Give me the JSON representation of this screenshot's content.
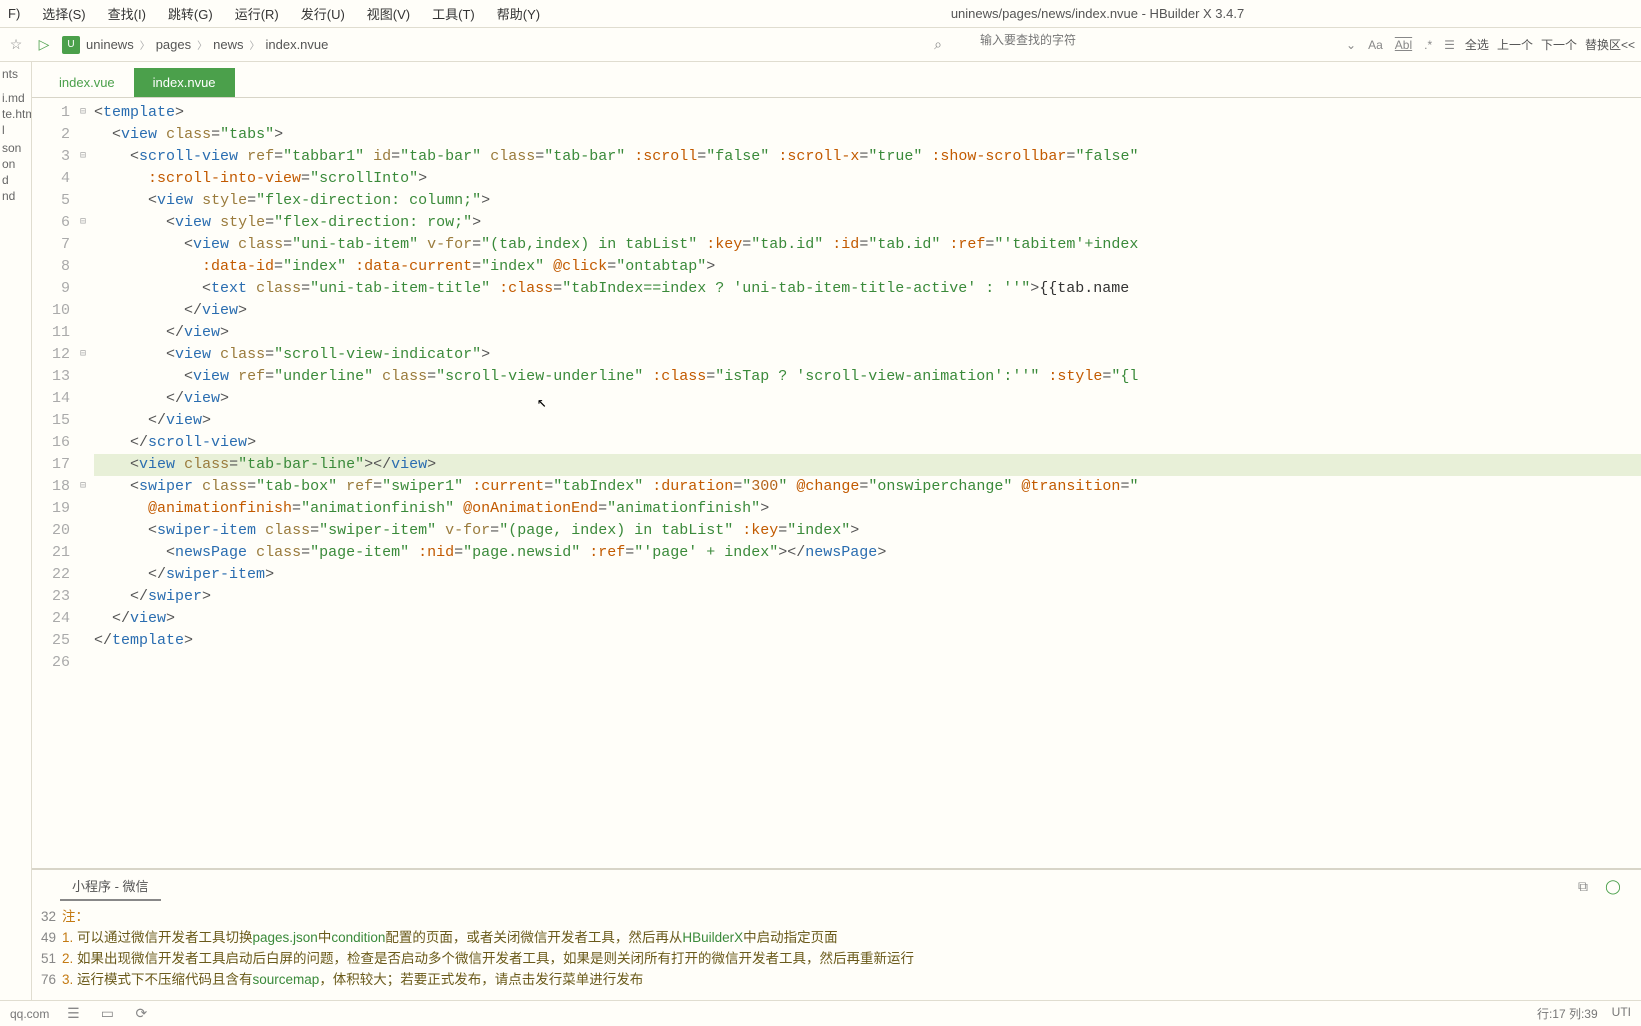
{
  "window_title": "uninews/pages/news/index.nvue - HBuilder X 3.4.7",
  "menu": {
    "file": "F)",
    "select": "选择(S)",
    "find": "查找(I)",
    "goto": "跳转(G)",
    "run": "运行(R)",
    "publish": "发行(U)",
    "view": "视图(V)",
    "tool": "工具(T)",
    "help": "帮助(Y)"
  },
  "breadcrumb": {
    "proj_icon": "U",
    "items": [
      "uninews",
      "pages",
      "news",
      "index.nvue"
    ]
  },
  "search": {
    "placeholder": "输入要查找的字符",
    "aa": "Aa",
    "abl": "Abl",
    "select_all": "全选",
    "prev": "上一个",
    "next": "下一个",
    "replace": "替换区<<"
  },
  "sidebar_files": [
    "nts",
    "",
    "",
    "",
    "",
    "i.md",
    "te.html",
    "l",
    "",
    "son",
    "on",
    "d",
    "nd"
  ],
  "tabs": [
    {
      "label": "index.vue",
      "active": false
    },
    {
      "label": "index.nvue",
      "active": true
    }
  ],
  "code": {
    "lines": [
      {
        "n": 1,
        "fold": "⊟",
        "html": "<span class='t-sym'>&lt;</span><span class='t-tag'>template</span><span class='t-sym'>&gt;</span>"
      },
      {
        "n": 2,
        "html": "  <span class='t-sym'>&lt;</span><span class='t-tag'>view</span> <span class='t-attr'>class</span><span class='t-sym'>=</span><span class='t-str'>\"tabs\"</span><span class='t-sym'>&gt;</span>"
      },
      {
        "n": 3,
        "fold": "⊟",
        "html": "    <span class='t-sym'>&lt;</span><span class='t-tag'>scroll-view</span> <span class='t-attr'>ref</span><span class='t-sym'>=</span><span class='t-str'>\"tabbar1\"</span> <span class='t-attr'>id</span><span class='t-sym'>=</span><span class='t-str'>\"tab-bar\"</span> <span class='t-attr'>class</span><span class='t-sym'>=</span><span class='t-str'>\"tab-bar\"</span> <span class='t-bind'>:scroll</span><span class='t-sym'>=</span><span class='t-str'>\"false\"</span> <span class='t-bind'>:scroll-x</span><span class='t-sym'>=</span><span class='t-str'>\"true\"</span> <span class='t-bind'>:show-scrollbar</span><span class='t-sym'>=</span><span class='t-str'>\"false\"</span>"
      },
      {
        "n": 4,
        "html": "      <span class='t-bind'>:scroll-into-view</span><span class='t-sym'>=</span><span class='t-str'>\"scrollInto\"</span><span class='t-sym'>&gt;</span>"
      },
      {
        "n": 5,
        "html": "      <span class='t-sym'>&lt;</span><span class='t-tag'>view</span> <span class='t-attr'>style</span><span class='t-sym'>=</span><span class='t-str'>\"flex-direction: column;\"</span><span class='t-sym'>&gt;</span>"
      },
      {
        "n": 6,
        "fold": "⊟",
        "html": "        <span class='t-sym'>&lt;</span><span class='t-tag'>view</span> <span class='t-attr'>style</span><span class='t-sym'>=</span><span class='t-str'>\"flex-direction: row;\"</span><span class='t-sym'>&gt;</span>"
      },
      {
        "n": 7,
        "html": "          <span class='t-sym'>&lt;</span><span class='t-tag'>view</span> <span class='t-attr'>class</span><span class='t-sym'>=</span><span class='t-str'>\"uni-tab-item\"</span> <span class='t-attr'>v-for</span><span class='t-sym'>=</span><span class='t-str'>\"(tab,index) in tabList\"</span> <span class='t-bind'>:key</span><span class='t-sym'>=</span><span class='t-str'>\"tab.id\"</span> <span class='t-bind'>:id</span><span class='t-sym'>=</span><span class='t-str'>\"tab.id\"</span> <span class='t-bind'>:ref</span><span class='t-sym'>=</span><span class='t-str'>\"'tabitem'+index</span>"
      },
      {
        "n": 8,
        "html": "            <span class='t-bind'>:data-id</span><span class='t-sym'>=</span><span class='t-str'>\"index\"</span> <span class='t-bind'>:data-current</span><span class='t-sym'>=</span><span class='t-str'>\"index\"</span> <span class='t-bind'>@click</span><span class='t-sym'>=</span><span class='t-str'>\"ontabtap\"</span><span class='t-sym'>&gt;</span>"
      },
      {
        "n": 9,
        "html": "            <span class='t-sym'>&lt;</span><span class='t-tag'>text</span> <span class='t-attr'>class</span><span class='t-sym'>=</span><span class='t-str'>\"uni-tab-item-title\"</span> <span class='t-bind'>:class</span><span class='t-sym'>=</span><span class='t-str'>\"tabIndex==index ? 'uni-tab-item-title-active' : ''\"</span><span class='t-sym'>&gt;</span><span class='t-expr'>{{tab.name</span>"
      },
      {
        "n": 10,
        "html": "          <span class='t-sym'>&lt;/</span><span class='t-tag'>view</span><span class='t-sym'>&gt;</span>"
      },
      {
        "n": 11,
        "html": "        <span class='t-sym'>&lt;/</span><span class='t-tag'>view</span><span class='t-sym'>&gt;</span>"
      },
      {
        "n": 12,
        "fold": "⊟",
        "html": "        <span class='t-sym'>&lt;</span><span class='t-tag'>view</span> <span class='t-attr'>class</span><span class='t-sym'>=</span><span class='t-str'>\"scroll-view-indicator\"</span><span class='t-sym'>&gt;</span>"
      },
      {
        "n": 13,
        "html": "          <span class='t-sym'>&lt;</span><span class='t-tag'>view</span> <span class='t-attr'>ref</span><span class='t-sym'>=</span><span class='t-str'>\"underline\"</span> <span class='t-attr'>class</span><span class='t-sym'>=</span><span class='t-str'>\"scroll-view-underline\"</span> <span class='t-bind'>:class</span><span class='t-sym'>=</span><span class='t-str'>\"isTap ? 'scroll-view-animation':''\"</span> <span class='t-bind'>:style</span><span class='t-sym'>=</span><span class='t-str'>\"{l</span>"
      },
      {
        "n": 14,
        "html": "        <span class='t-sym'>&lt;/</span><span class='t-tag'>view</span><span class='t-sym'>&gt;</span>"
      },
      {
        "n": 15,
        "html": "      <span class='t-sym'>&lt;/</span><span class='t-tag'>view</span><span class='t-sym'>&gt;</span>"
      },
      {
        "n": 16,
        "html": "    <span class='t-sym'>&lt;/</span><span class='t-tag'>scroll-view</span><span class='t-sym'>&gt;</span>"
      },
      {
        "n": 17,
        "hl": true,
        "html": "    <span class='t-sym'>&lt;</span><span class='t-tag'>view</span> <span class='t-attr'>class</span><span class='t-sym'>=</span><span class='t-str'>\"tab-bar-line\"</span><span class='t-sym'>&gt;&lt;/</span><span class='t-tag'>view</span><span class='t-sym'>&gt;</span>"
      },
      {
        "n": 18,
        "fold": "⊟",
        "html": "    <span class='t-sym'>&lt;</span><span class='t-tag'>swiper</span> <span class='t-attr'>class</span><span class='t-sym'>=</span><span class='t-str'>\"tab-box\"</span> <span class='t-attr'>ref</span><span class='t-sym'>=</span><span class='t-str'>\"swiper1\"</span> <span class='t-bind'>:current</span><span class='t-sym'>=</span><span class='t-str'>\"tabIndex\"</span> <span class='t-bind'>:duration</span><span class='t-sym'>=</span><span class='t-str'>\"</span><span class='t-num'>300</span><span class='t-str'>\"</span> <span class='t-bind'>@change</span><span class='t-sym'>=</span><span class='t-str'>\"onswiperchange\"</span> <span class='t-bind'>@transition</span><span class='t-sym'>=</span><span class='t-str'>\"</span>"
      },
      {
        "n": 19,
        "html": "      <span class='t-bind'>@animationfinish</span><span class='t-sym'>=</span><span class='t-str'>\"animationfinish\"</span> <span class='t-bind'>@onAnimationEnd</span><span class='t-sym'>=</span><span class='t-str'>\"animationfinish\"</span><span class='t-sym'>&gt;</span>"
      },
      {
        "n": 20,
        "html": "      <span class='t-sym'>&lt;</span><span class='t-tag'>swiper-item</span> <span class='t-attr'>class</span><span class='t-sym'>=</span><span class='t-str'>\"swiper-item\"</span> <span class='t-attr'>v-for</span><span class='t-sym'>=</span><span class='t-str'>\"(page, index) in tabList\"</span> <span class='t-bind'>:key</span><span class='t-sym'>=</span><span class='t-str'>\"index\"</span><span class='t-sym'>&gt;</span>"
      },
      {
        "n": 21,
        "html": "        <span class='t-sym'>&lt;</span><span class='t-tag'>newsPage</span> <span class='t-attr'>class</span><span class='t-sym'>=</span><span class='t-str'>\"page-item\"</span> <span class='t-bind'>:nid</span><span class='t-sym'>=</span><span class='t-str'>\"page.newsid\"</span> <span class='t-bind'>:ref</span><span class='t-sym'>=</span><span class='t-str'>\"'page' + index\"</span><span class='t-sym'>&gt;&lt;/</span><span class='t-tag'>newsPage</span><span class='t-sym'>&gt;</span>"
      },
      {
        "n": 22,
        "html": "      <span class='t-sym'>&lt;/</span><span class='t-tag'>swiper-item</span><span class='t-sym'>&gt;</span>"
      },
      {
        "n": 23,
        "html": "    <span class='t-sym'>&lt;/</span><span class='t-tag'>swiper</span><span class='t-sym'>&gt;</span>"
      },
      {
        "n": 24,
        "html": "  <span class='t-sym'>&lt;/</span><span class='t-tag'>view</span><span class='t-sym'>&gt;</span>"
      },
      {
        "n": 25,
        "html": "<span class='t-sym'>&lt;/</span><span class='t-tag'>template</span><span class='t-sym'>&gt;</span>"
      },
      {
        "n": 26,
        "html": ""
      }
    ]
  },
  "console": {
    "tab": "小程序 - 微信",
    "rows": [
      {
        "ln": "32",
        "html": "<span class='c-orange'>注：</span>"
      },
      {
        "ln": "49",
        "html": "<span class='c-orange'>1. </span><span class='c-text'>可以通过微信开发者工具切换</span><span class='c-green'>pages.json</span><span class='c-text'>中</span><span class='c-green'>condition</span><span class='c-text'>配置的页面，或者关闭微信开发者工具，然后再从</span><span class='c-green'>HBuilderX</span><span class='c-text'>中启动指定页面</span>"
      },
      {
        "ln": "51",
        "html": "<span class='c-orange'>2. </span><span class='c-text'>如果出现微信开发者工具启动后白屏的问题，检查是否启动多个微信开发者工具，如果是则关闭所有打开的微信开发者工具，然后再重新运行</span>"
      },
      {
        "ln": "76",
        "html": "<span class='c-orange'>3. </span><span class='c-text'>运行模式下不压缩代码且含有</span><span class='c-green'>sourcemap</span><span class='c-text'>，体积较大；若要正式发布，请点击发行菜单进行发布</span>"
      }
    ]
  },
  "status": {
    "left": "qq.com",
    "line_col": "行:17 列:39",
    "enc": "UTI"
  }
}
